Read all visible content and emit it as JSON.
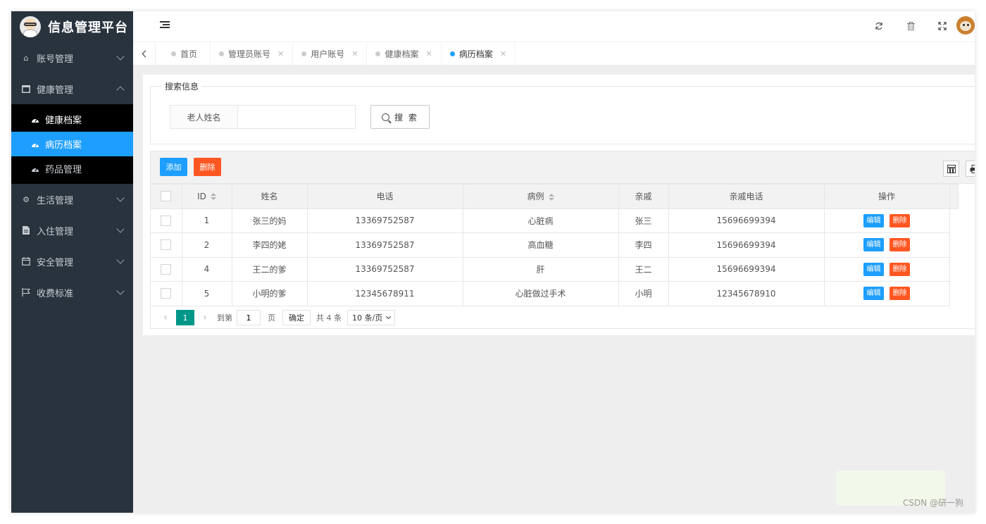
{
  "app": {
    "title": "信息管理平台"
  },
  "sidebar": {
    "items": [
      {
        "label": "账号管理",
        "icon": "home-icon",
        "expanded": false
      },
      {
        "label": "健康管理",
        "icon": "window-icon",
        "expanded": true,
        "children": [
          {
            "label": "健康档案",
            "icon": "dashboard-icon",
            "active": false
          },
          {
            "label": "病历档案",
            "icon": "dashboard-icon",
            "active": true
          },
          {
            "label": "药品管理",
            "icon": "dashboard-icon",
            "active": false
          }
        ]
      },
      {
        "label": "生活管理",
        "icon": "gears-icon",
        "expanded": false
      },
      {
        "label": "入住管理",
        "icon": "file-icon",
        "expanded": false
      },
      {
        "label": "安全管理",
        "icon": "calendar-icon",
        "expanded": false
      },
      {
        "label": "收费标准",
        "icon": "flag-icon",
        "expanded": false
      }
    ]
  },
  "tabs": [
    {
      "label": "首页",
      "closable": false,
      "active": false
    },
    {
      "label": "管理员账号",
      "closable": true,
      "active": false
    },
    {
      "label": "用户账号",
      "closable": true,
      "active": false
    },
    {
      "label": "健康档案",
      "closable": true,
      "active": false
    },
    {
      "label": "病历档案",
      "closable": true,
      "active": true
    }
  ],
  "search": {
    "legend": "搜索信息",
    "field_label": "老人姓名",
    "value": "",
    "button_label": "搜 索"
  },
  "toolbar": {
    "add_label": "添加",
    "delete_label": "删除"
  },
  "table": {
    "columns": [
      "ID",
      "姓名",
      "电话",
      "病例",
      "亲戚",
      "亲戚电话",
      "操作"
    ],
    "rows": [
      {
        "id": "1",
        "name": "张三的妈",
        "phone": "13369752587",
        "case": "心脏病",
        "relative": "张三",
        "relative_phone": "15696699394"
      },
      {
        "id": "2",
        "name": "李四的姥",
        "phone": "13369752587",
        "case": "高血糖",
        "relative": "李四",
        "relative_phone": "15696699394"
      },
      {
        "id": "4",
        "name": "王二的爹",
        "phone": "13369752587",
        "case": "肝",
        "relative": "王二",
        "relative_phone": "15696699394"
      },
      {
        "id": "5",
        "name": "小明的爹",
        "phone": "12345678911",
        "case": "心脏做过手术",
        "relative": "小明",
        "relative_phone": "12345678910"
      }
    ],
    "edit_label": "编辑",
    "delete_label": "删除"
  },
  "pager": {
    "current_page": "1",
    "goto_prefix": "到第",
    "goto_value": "1",
    "goto_suffix": "页",
    "confirm_label": "确定",
    "total_text": "共 4 条",
    "page_size": "10 条/页"
  },
  "watermark": "CSDN @研一狗"
}
